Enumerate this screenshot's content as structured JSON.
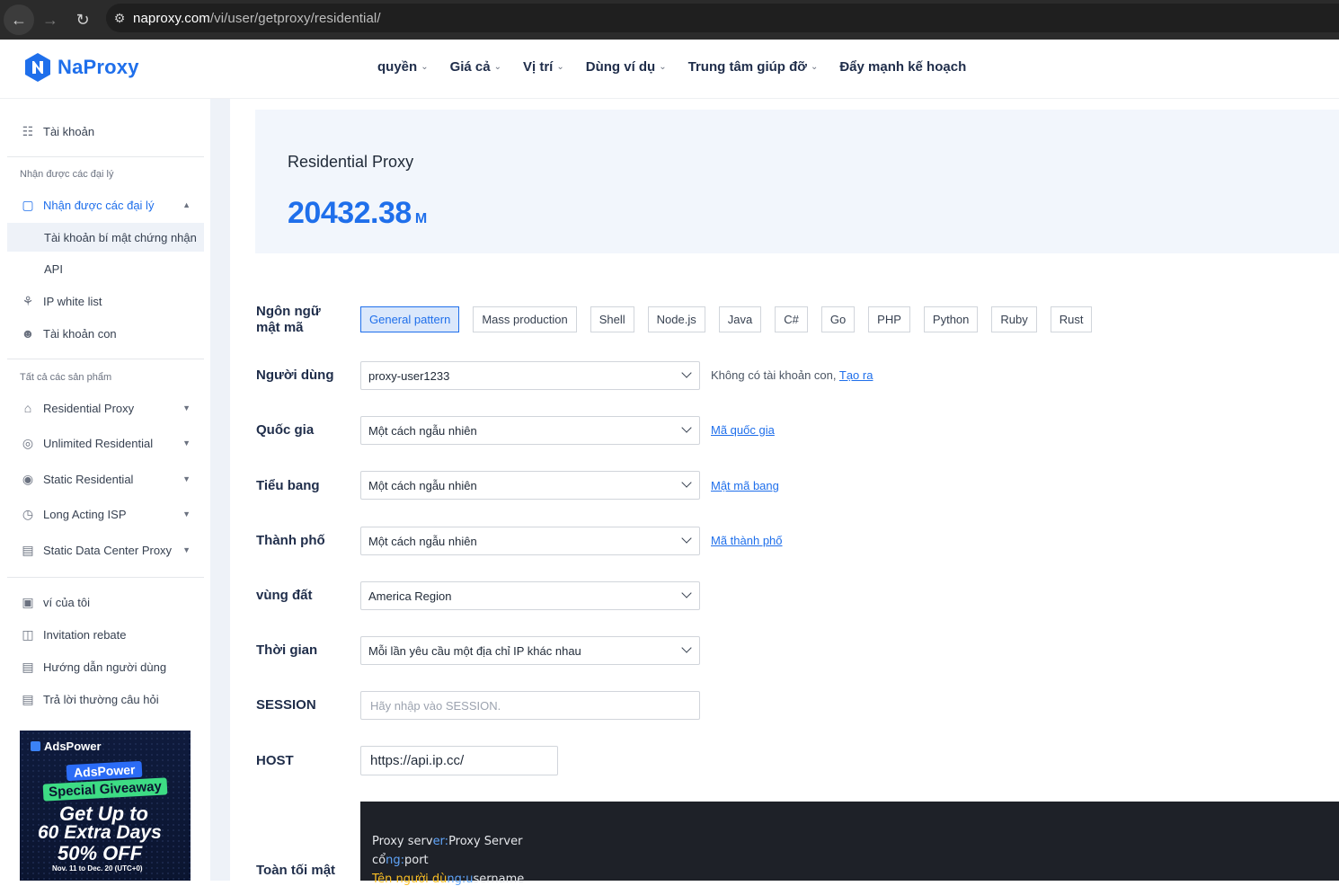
{
  "browser": {
    "url_host": "naproxy.com",
    "url_path": "/vi/user/getproxy/residential/"
  },
  "header": {
    "logo_text": "NaProxy",
    "nav": [
      {
        "label": "quyền"
      },
      {
        "label": "Giá cả"
      },
      {
        "label": "Vị trí"
      },
      {
        "label": "Dùng ví dụ"
      },
      {
        "label": "Trung tâm giúp đỡ"
      },
      {
        "label": "Đẩy mạnh kế hoạch"
      }
    ]
  },
  "sidebar": {
    "account": "Tài khoản",
    "section_agents": "Nhận được các đại lý",
    "agents_parent": "Nhận được các đại lý",
    "agents_sub": [
      "Tài khoản bí mật chứng nhận",
      "API"
    ],
    "ip_whitelist": "IP white list",
    "sub_account": "Tài khoản con",
    "section_products": "Tất cả các sản phẩm",
    "products": [
      "Residential Proxy",
      "Unlimited Residential",
      "Static Residential",
      "Long Acting ISP",
      "Static Data Center Proxy"
    ],
    "wallet": "ví của tôi",
    "invitation": "Invitation rebate",
    "guide": "Hướng dẫn người dùng",
    "faq": "Trả lời thường câu hỏi",
    "ad": {
      "brand": "AdsPower",
      "pill": "AdsPower",
      "giveaway": "Special Giveaway",
      "line1": "Get Up to",
      "line2": "60 Extra Days",
      "line3": "50% OFF",
      "date": "Nov. 11 to Dec. 20 (UTC+0)"
    }
  },
  "balance": {
    "title": "Residential Proxy",
    "amount": "20432.38",
    "unit": "M"
  },
  "form": {
    "lang_label": "Ngôn ngữ mật mã",
    "lang_tabs": [
      "General pattern",
      "Mass production",
      "Shell",
      "Node.js",
      "Java",
      "C#",
      "Go",
      "PHP",
      "Python",
      "Ruby",
      "Rust"
    ],
    "active_tab": "General pattern",
    "user_label": "Người dùng",
    "user_value": "proxy-user1233",
    "user_note": "Không có tài khoản con,",
    "user_note_link": "Tạo ra",
    "country_label": "Quốc gia",
    "country_value": "Một cách ngẫu nhiên",
    "country_link": "Mã quốc gia",
    "state_label": "Tiểu bang",
    "state_value": "Một cách ngẫu nhiên",
    "state_link": "Mật mã bang",
    "city_label": "Thành phố",
    "city_value": "Một cách ngẫu nhiên",
    "city_link": "Mã thành phố",
    "region_label": "vùng đất",
    "region_value": "America Region",
    "time_label": "Thời gian",
    "time_value": "Mỗi lần yêu cầu một địa chỉ IP khác nhau",
    "session_label": "SESSION",
    "session_placeholder": "Hãy nhập vào SESSION.",
    "host_label": "HOST",
    "host_value": "https://api.ip.cc/",
    "secret_label": "Toàn tối mật"
  },
  "code": {
    "line1_a": "Proxy serv",
    "line1_b": "er:",
    "line1_c": "Proxy Server",
    "line2_a": "cổ",
    "line2_b": "ng:",
    "line2_c": "port",
    "line3_a": "Tên người dù",
    "line3_b": "ng:u",
    "line3_c": "sername"
  }
}
